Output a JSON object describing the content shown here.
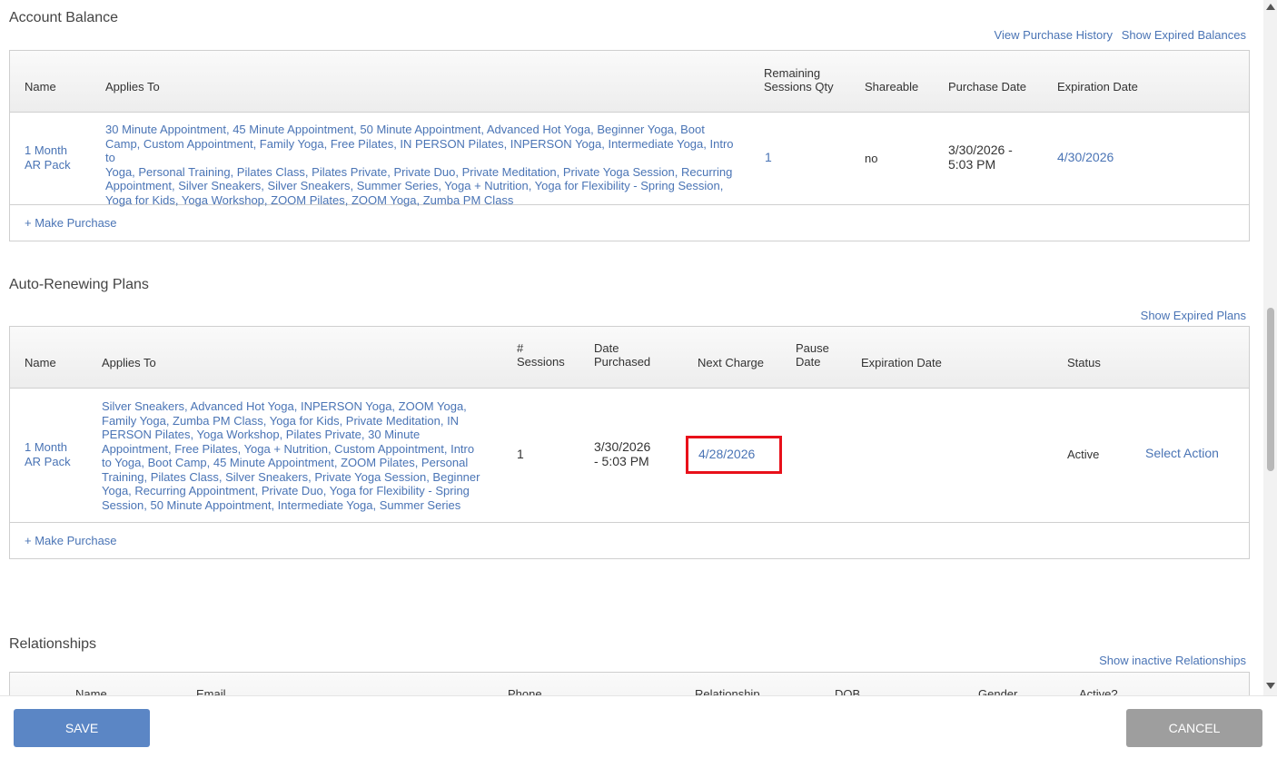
{
  "account_balance": {
    "title": "Account Balance",
    "links": {
      "purchase_history": "View Purchase History",
      "expired_balances": "Show Expired Balances"
    },
    "headers": {
      "name": "Name",
      "applies_to": "Applies To",
      "remaining_1": "Remaining",
      "remaining_2": "Sessions Qty",
      "shareable": "Shareable",
      "purchase_date": "Purchase Date",
      "expiration_date": "Expiration Date"
    },
    "row": {
      "name_1": "1 Month",
      "name_2": "AR Pack",
      "applies_lines": [
        "30 Minute Appointment, 45 Minute Appointment, 50 Minute Appointment, Advanced Hot Yoga, Beginner Yoga, Boot",
        "Camp, Custom Appointment, Family Yoga, Free Pilates, IN PERSON Pilates, INPERSON Yoga, Intermediate Yoga, Intro to",
        "Yoga, Personal Training, Pilates Class, Pilates Private, Private Duo, Private Meditation, Private Yoga Session, Recurring",
        "Appointment, Silver Sneakers, Silver Sneakers, Summer Series, Yoga + Nutrition, Yoga for Flexibility - Spring Session,",
        "Yoga for Kids, Yoga Workshop, ZOOM Pilates, ZOOM Yoga, Zumba PM Class"
      ],
      "remaining": "1",
      "shareable": "no",
      "purchase_date_1": "3/30/2026 -",
      "purchase_date_2": "5:03 PM",
      "expiration_date": "4/30/2026"
    },
    "make_purchase": "+ Make Purchase"
  },
  "auto_renewing": {
    "title": "Auto-Renewing Plans",
    "links": {
      "expired_plans": "Show Expired Plans"
    },
    "headers": {
      "name": "Name",
      "applies_to": "Applies To",
      "sessions_1": "#",
      "sessions_2": "Sessions",
      "date_purchased_1": "Date",
      "date_purchased_2": "Purchased",
      "next_charge": "Next Charge",
      "pause_date_1": "Pause",
      "pause_date_2": "Date",
      "expiration_date": "Expiration Date",
      "status": "Status"
    },
    "row": {
      "name_1": "1 Month",
      "name_2": "AR Pack",
      "applies_lines": [
        "Silver Sneakers, Advanced Hot Yoga, INPERSON Yoga, ZOOM Yoga,",
        "Family Yoga, Zumba PM Class, Yoga for Kids, Private Meditation, IN",
        "PERSON Pilates, Yoga Workshop, Pilates Private, 30 Minute",
        "Appointment, Free Pilates, Yoga + Nutrition, Custom Appointment, Intro",
        "to Yoga, Boot Camp, 45 Minute Appointment, ZOOM Pilates, Personal",
        "Training, Pilates Class, Silver Sneakers, Private Yoga Session, Beginner",
        "Yoga, Recurring Appointment, Private Duo, Yoga for Flexibility - Spring",
        "Session, 50 Minute Appointment, Intermediate Yoga, Summer Series"
      ],
      "sessions": "1",
      "date_purchased_1": "3/30/2026",
      "date_purchased_2": "- 5:03 PM",
      "next_charge": "4/28/2026",
      "status": "Active",
      "action": "Select Action"
    },
    "make_purchase": "+ Make Purchase"
  },
  "relationships": {
    "title": "Relationships",
    "links": {
      "inactive": "Show inactive Relationships"
    },
    "headers": {
      "name": "Name",
      "email": "Email",
      "phone": "Phone",
      "relationship": "Relationship",
      "dob": "DOB",
      "gender": "Gender",
      "active": "Active?"
    }
  },
  "footer": {
    "save": "SAVE",
    "cancel": "CANCEL"
  },
  "colors": {
    "link": "#4a74b5",
    "highlight": "#e8101a",
    "save_bg": "#5b86c5",
    "cancel_bg": "#9e9e9e"
  }
}
